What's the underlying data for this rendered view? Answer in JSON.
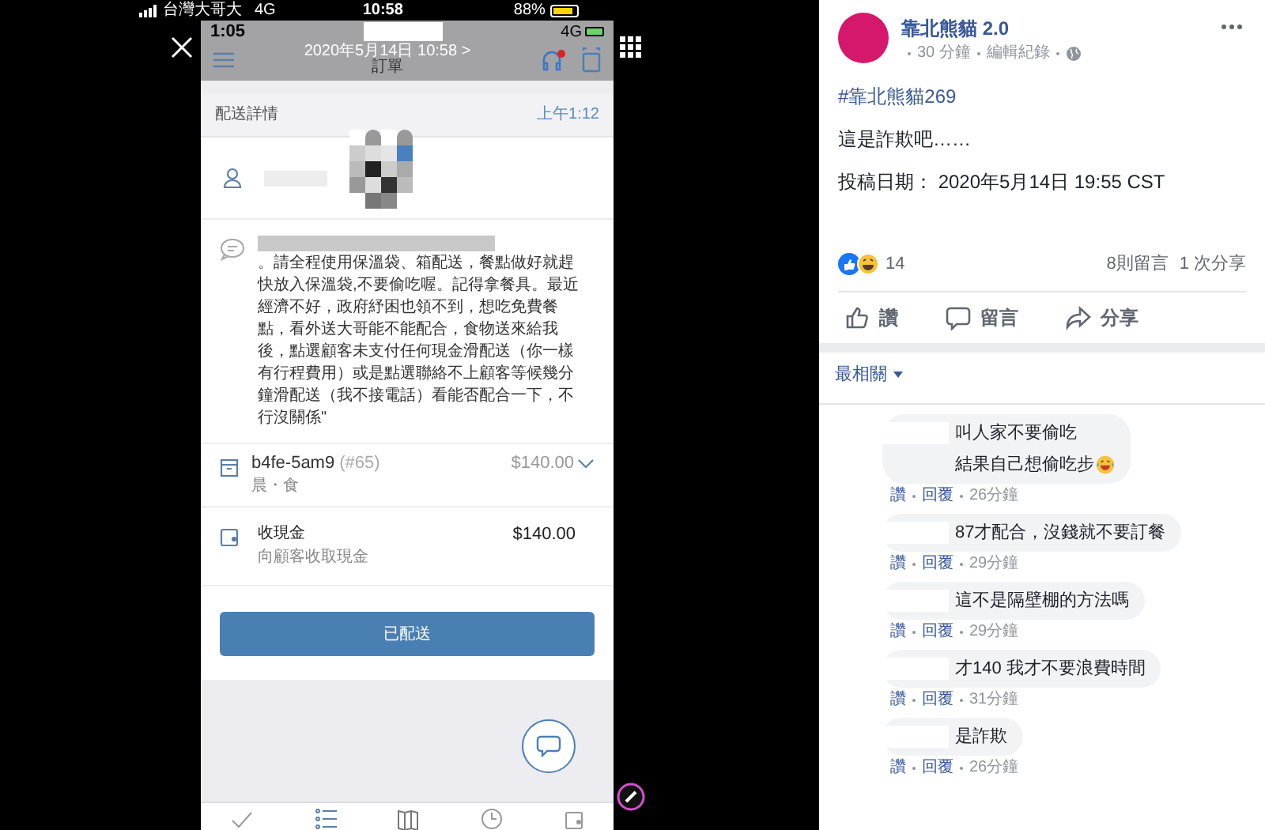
{
  "status_bar": {
    "carrier": "台灣大哥大",
    "network": "4G",
    "time": "10:58",
    "battery": "88%"
  },
  "phone": {
    "time": "1:05",
    "network": "4G",
    "date": "2020年5月14日 10:58 >",
    "title": "訂單",
    "section": "配送詳情",
    "section_time": "上午1:12",
    "note": "。請全程使用保溫袋、箱配送，餐點做好就趕快放入保溫袋,不要偷吃喔。記得拿餐具。最近經濟不好，政府紓困也領不到，想吃免費餐點，看外送大哥能不能配合，食物送來給我後，點選顧客未支付任何現金滑配送（你一樣有行程費用）或是點選聯絡不上顧客等候幾分鐘滑配送（我不接電話）看能否配合一下，不行沒關係\"",
    "order": {
      "id": "b4fe-5am9",
      "number": "(#65)",
      "price": "$140.00",
      "subtitle": "晨・食"
    },
    "payment": {
      "title": "收現金",
      "amount": "$140.00",
      "subtitle": "向顧客收取現金"
    },
    "button": "已配送"
  },
  "post": {
    "page_name": "靠北熊貓 2.0",
    "time": "30 分鐘",
    "edit_history": "編輯紀錄",
    "hashtag": "#靠北熊貓269",
    "lines": [
      "這是詐欺吧……",
      "投稿日期： 2020年5月14日 19:55 CST"
    ],
    "reaction_count": "14",
    "comment_count": "8則留言",
    "share_count": "1 次分享",
    "actions": [
      {
        "kind": "like",
        "label": "讚"
      },
      {
        "kind": "comment",
        "label": "留言"
      },
      {
        "kind": "share",
        "label": "分享"
      }
    ],
    "sort": "最相關"
  },
  "comments": [
    {
      "lines": [
        "叫人家不要偷吃",
        "結果自己想偷吃步"
      ],
      "emoji": true,
      "like": "讚",
      "reply": "回覆",
      "time": "26分鐘"
    },
    {
      "lines": [
        "87才配合，沒錢就不要訂餐"
      ],
      "emoji": false,
      "like": "讚",
      "reply": "回覆",
      "time": "29分鐘"
    },
    {
      "lines": [
        "這不是隔壁棚的方法嗎"
      ],
      "emoji": false,
      "like": "讚",
      "reply": "回覆",
      "time": "29分鐘"
    },
    {
      "lines": [
        "才140 我才不要浪費時間"
      ],
      "emoji": false,
      "like": "讚",
      "reply": "回覆",
      "time": "31分鐘"
    },
    {
      "lines": [
        "是詐欺"
      ],
      "emoji": false,
      "like": "讚",
      "reply": "回覆",
      "time": "26分鐘"
    }
  ]
}
